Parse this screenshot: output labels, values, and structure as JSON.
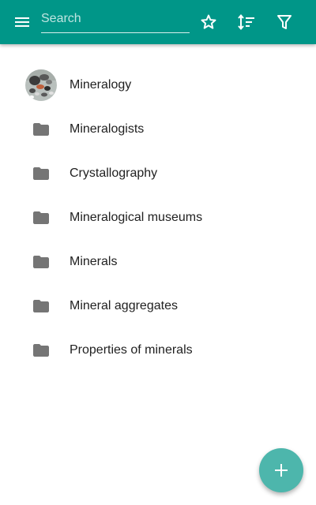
{
  "colors": {
    "appbar": "#009688",
    "fab": "#4DB6AC",
    "folder": "#757575",
    "text": "#212121"
  },
  "appbar": {
    "menu_icon": "menu-icon",
    "search": {
      "placeholder": "Search",
      "value": ""
    },
    "actions": [
      {
        "icon": "star-outline-icon"
      },
      {
        "icon": "sort-icon"
      },
      {
        "icon": "filter-icon"
      }
    ]
  },
  "list": {
    "items": [
      {
        "label": "Mineralogy",
        "icon": "category-thumbnail"
      },
      {
        "label": "Mineralogists",
        "icon": "folder-icon"
      },
      {
        "label": "Crystallography",
        "icon": "folder-icon"
      },
      {
        "label": "Mineralogical museums",
        "icon": "folder-icon"
      },
      {
        "label": "Minerals",
        "icon": "folder-icon"
      },
      {
        "label": "Mineral aggregates",
        "icon": "folder-icon"
      },
      {
        "label": "Properties of minerals",
        "icon": "folder-icon"
      }
    ]
  },
  "fab": {
    "icon": "add-icon"
  }
}
